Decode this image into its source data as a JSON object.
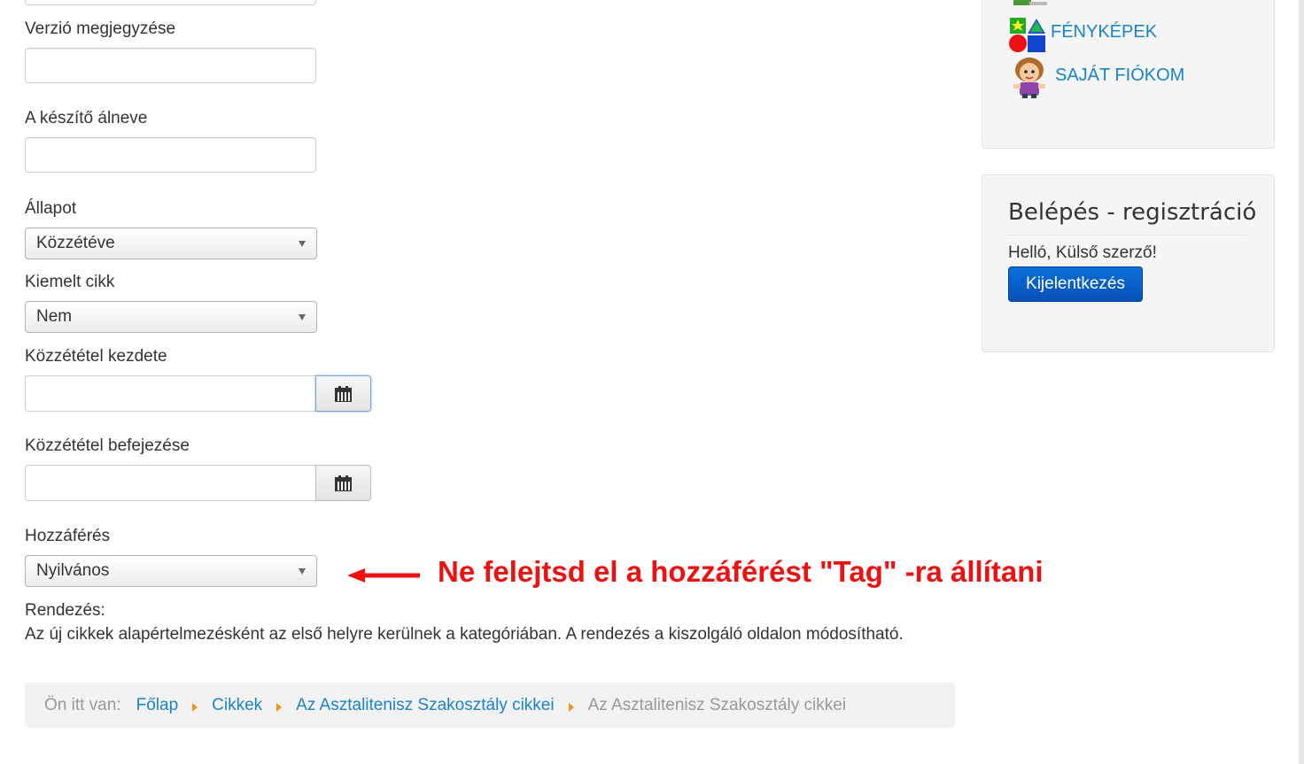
{
  "form": {
    "version_note_label": "Verzió megjegyzése",
    "author_alias_label": "A készítő álneve",
    "state_label": "Állapot",
    "state_value": "Közzétéve",
    "featured_label": "Kiemelt cikk",
    "featured_value": "Nem",
    "publish_up_label": "Közzététel kezdete",
    "publish_down_label": "Közzététel befejezése",
    "access_label": "Hozzáférés",
    "access_value": "Nyilvános",
    "ordering_label": "Rendezés:",
    "ordering_text": "Az új cikkek alapértelmezésként az első helyre kerülnek a kategóriában. A rendezés a kiszolgáló oldalon módosítható."
  },
  "annotation": {
    "text": "Ne felejtsd el a hozzáférést \"Tag\" -ra állítani",
    "color": "#ee1111"
  },
  "sidebar": {
    "menu_items": [
      {
        "label": "FÉNYKÉPEK",
        "icon": "shapes-icon"
      },
      {
        "label": "SAJÁT FIÓKOM",
        "icon": "user-avatar-icon"
      }
    ],
    "login_module": {
      "title": "Belépés - regisztráció",
      "greeting": "Helló, Külső szerző!",
      "logout_label": "Kijelentkezés"
    }
  },
  "breadcrumb": {
    "prefix": "Ön itt van:",
    "items": [
      "Főlap",
      "Cikkek",
      "Az Asztalitenisz Szakosztály cikkei"
    ],
    "current": "Az Asztalitenisz Szakosztály cikkei"
  },
  "colors": {
    "link": "#1a84c7",
    "primary_button": "#0650b8",
    "breadcrumb_separator": "#e8961f"
  }
}
